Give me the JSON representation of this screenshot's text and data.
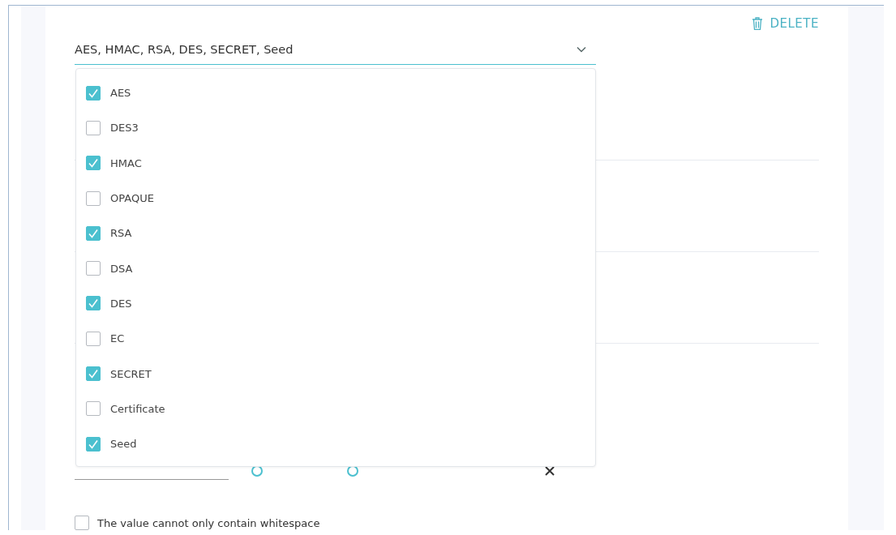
{
  "delete_button": {
    "label": "DELETE"
  },
  "key_type_select": {
    "value": "AES, HMAC, RSA, DES, SECRET, Seed",
    "expanded": true
  },
  "options": [
    {
      "label": "AES",
      "checked": true
    },
    {
      "label": "DES3",
      "checked": false
    },
    {
      "label": "HMAC",
      "checked": true
    },
    {
      "label": "OPAQUE",
      "checked": false
    },
    {
      "label": "RSA",
      "checked": true
    },
    {
      "label": "DSA",
      "checked": false
    },
    {
      "label": "DES",
      "checked": true
    },
    {
      "label": "EC",
      "checked": false
    },
    {
      "label": "SECRET",
      "checked": true
    },
    {
      "label": "Certificate",
      "checked": false
    },
    {
      "label": "Seed",
      "checked": true
    }
  ],
  "whitespace_rule": {
    "label": "The value cannot only contain whitespace",
    "checked": false
  }
}
